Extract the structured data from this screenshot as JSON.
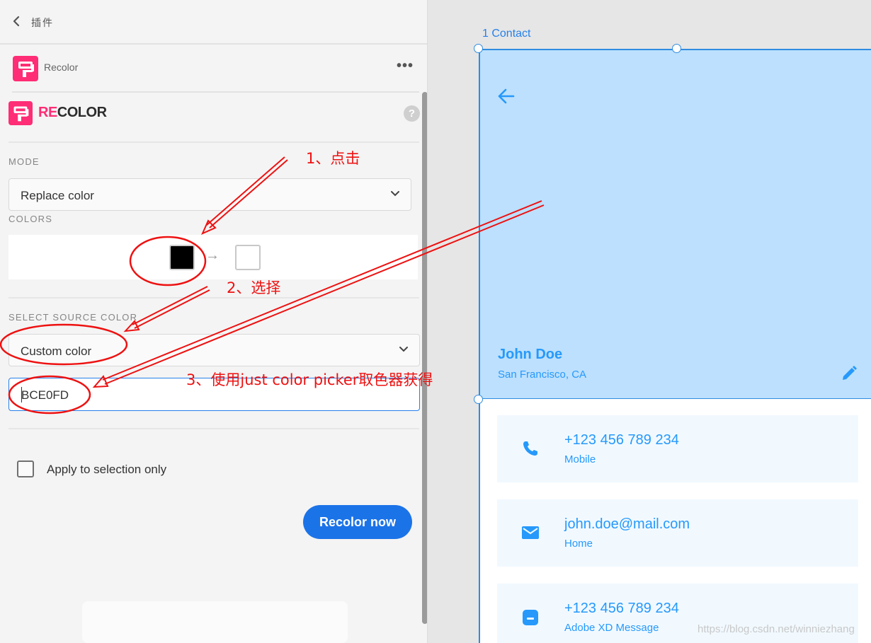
{
  "topbar": {
    "title": "插件"
  },
  "plugin": {
    "name": "Recolor",
    "more": "•••"
  },
  "brand": {
    "part1": "RE",
    "part2": "COLOR",
    "help": "?"
  },
  "mode": {
    "label": "MODE",
    "value": "Replace color"
  },
  "colors": {
    "label": "COLORS",
    "arrow": "→",
    "source_color": "#000000",
    "target_color": "#ffffff"
  },
  "source": {
    "label": "SELECT SOURCE COLOR",
    "value": "Custom color",
    "hex": "BCE0FD"
  },
  "apply": {
    "label": "Apply to selection only",
    "checked": false
  },
  "recolor_button": "Recolor now",
  "artboard": {
    "label": "1 Contact"
  },
  "profile": {
    "name": "John Doe",
    "location": "San Francisco, CA"
  },
  "contacts": [
    {
      "icon": "phone-icon",
      "value": "+123 456 789 234",
      "type": "Mobile"
    },
    {
      "icon": "mail-icon",
      "value": "john.doe@mail.com",
      "type": "Home"
    },
    {
      "icon": "message-icon",
      "value": "+123 456 789 234",
      "type": "Adobe XD Message"
    }
  ],
  "annotations": {
    "step1": "1、点击",
    "step2": "2、选择",
    "step3": "3、使用just color picker取色器获得"
  },
  "watermark": "https://blog.csdn.net/winniezhang",
  "colors_theme": {
    "accent": "#2680eb",
    "hero": "#bce0fd",
    "brand_pink": "#ff2d75",
    "annotation": "#ee1111"
  }
}
